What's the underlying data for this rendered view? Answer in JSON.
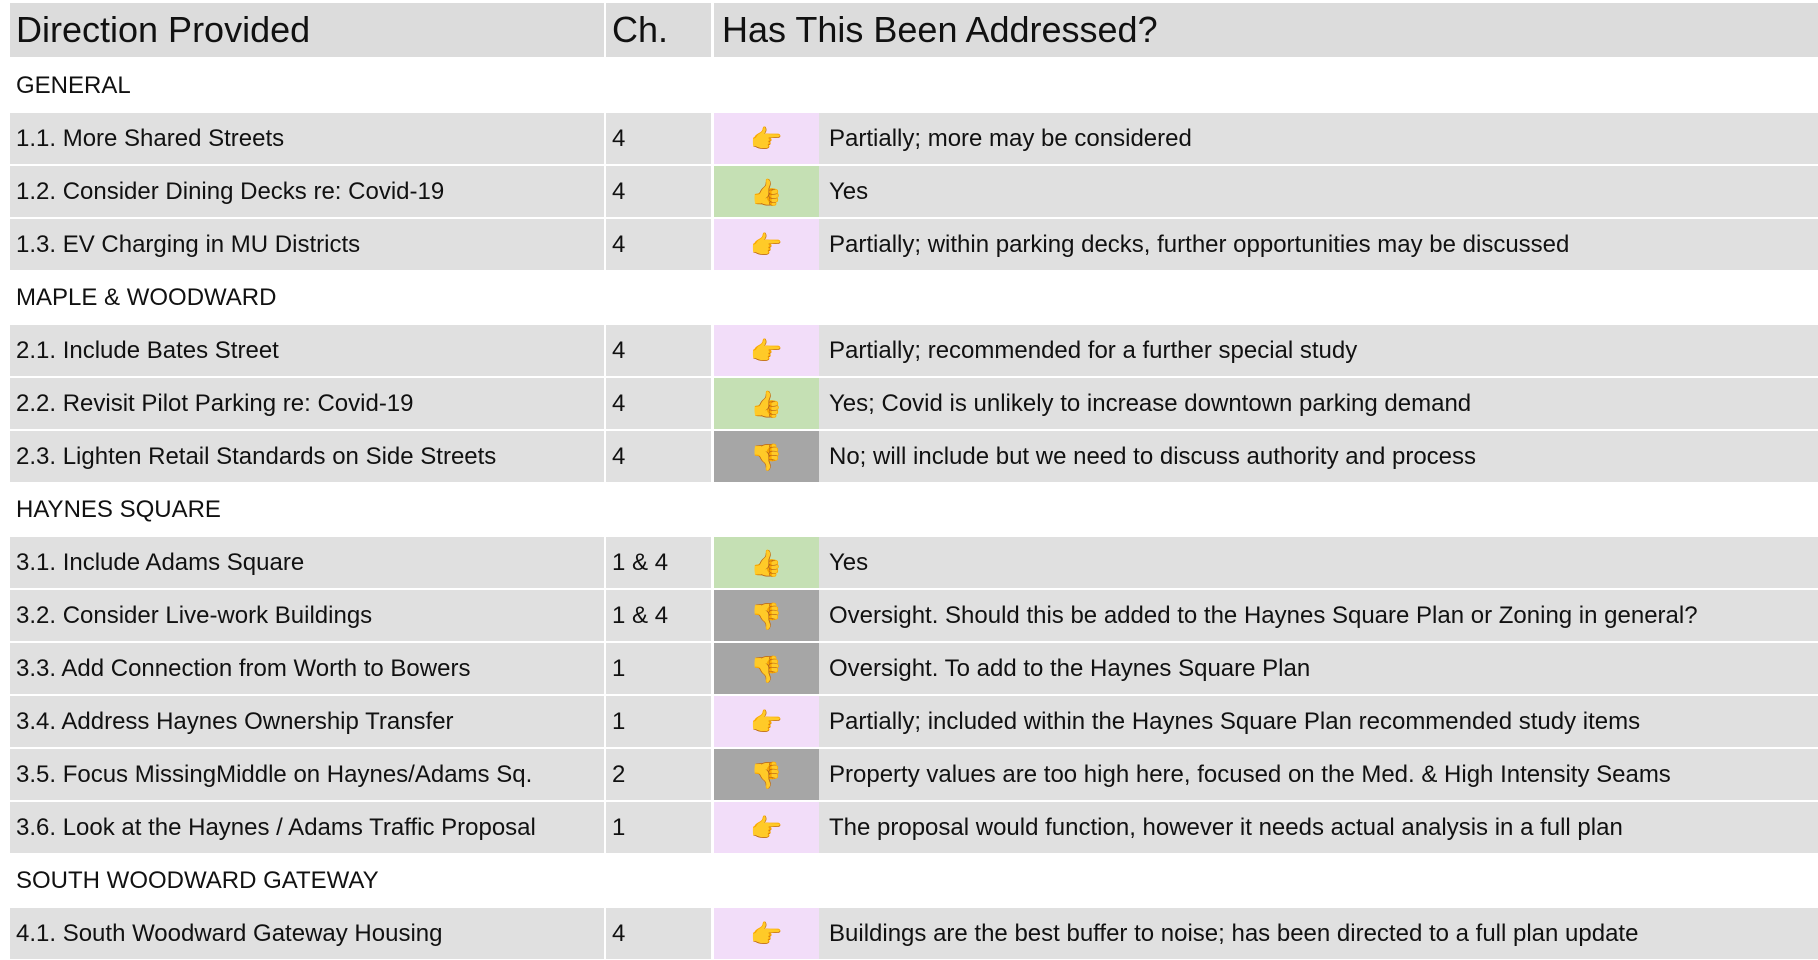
{
  "header": {
    "direction": "Direction Provided",
    "chapter": "Ch.",
    "addressed": "Has This Been Addressed?"
  },
  "colors": {
    "partial": "#f2ddf9",
    "yes": "#c5e0b4",
    "no": "#a6a6a6",
    "row_shade": "#e0e0e0",
    "header_bg": "#dcdcdc"
  },
  "icons": {
    "partial": "point-right-icon",
    "yes": "thumbs-up-icon",
    "no": "thumbs-down-icon"
  },
  "sections": [
    {
      "title": "GENERAL",
      "rows": [
        {
          "direction": "1.1. More Shared Streets",
          "chapter": "4",
          "status": "partial",
          "answer": "Partially; more may be considered"
        },
        {
          "direction": "1.2. Consider Dining Decks re: Covid-19",
          "chapter": "4",
          "status": "yes",
          "answer": "Yes"
        },
        {
          "direction": "1.3. EV Charging in MU Districts",
          "chapter": "4",
          "status": "partial",
          "answer": "Partially; within parking decks, further opportunities may be discussed"
        }
      ]
    },
    {
      "title": "MAPLE & WOODWARD",
      "rows": [
        {
          "direction": "2.1. Include Bates Street",
          "chapter": "4",
          "status": "partial",
          "answer": "Partially; recommended for a further special study"
        },
        {
          "direction": "2.2. Revisit Pilot Parking re: Covid-19",
          "chapter": "4",
          "status": "yes",
          "answer": "Yes; Covid is unlikely to increase downtown parking demand"
        },
        {
          "direction": "2.3. Lighten Retail Standards on Side Streets",
          "chapter": "4",
          "status": "no",
          "answer": "No; will include but we need to discuss authority and process"
        }
      ]
    },
    {
      "title": "HAYNES SQUARE",
      "rows": [
        {
          "direction": "3.1. Include Adams Square",
          "chapter": "1 & 4",
          "status": "yes",
          "answer": "Yes"
        },
        {
          "direction": "3.2. Consider Live-work Buildings",
          "chapter": "1 & 4",
          "status": "no",
          "answer": "Oversight. Should this be added to the Haynes Square Plan or Zoning in general?"
        },
        {
          "direction": "3.3. Add Connection from Worth to Bowers",
          "chapter": "1",
          "status": "no",
          "answer": "Oversight. To add to the Haynes Square Plan"
        },
        {
          "direction": "3.4. Address Haynes Ownership Transfer",
          "chapter": "1",
          "status": "partial",
          "answer": "Partially; included within the Haynes Square Plan recommended study items"
        },
        {
          "direction": "3.5. Focus MissingMiddle on Haynes/Adams Sq.",
          "chapter": "2",
          "status": "no",
          "answer": "Property values are too high here, focused on the Med. & High Intensity Seams"
        },
        {
          "direction": "3.6. Look at the Haynes / Adams Traffic Proposal",
          "chapter": "1",
          "status": "partial",
          "answer": "The proposal would function, however it needs actual analysis in a full plan"
        }
      ]
    },
    {
      "title": "SOUTH WOODWARD GATEWAY",
      "rows": [
        {
          "direction": "4.1. South Woodward Gateway Housing",
          "chapter": "4",
          "status": "partial",
          "answer": "Buildings are the best buffer to noise; has been directed to a full plan update"
        }
      ]
    }
  ]
}
